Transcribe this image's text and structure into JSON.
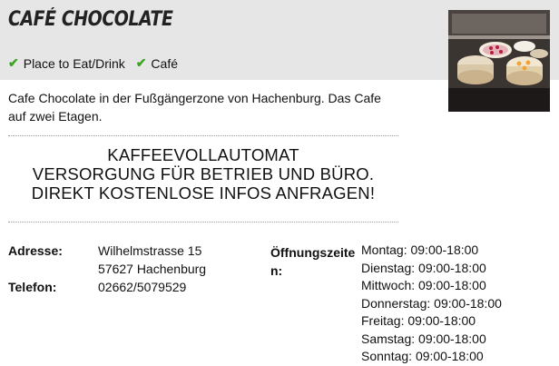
{
  "listing": {
    "title": "CAFÉ CHOCOLATE",
    "categories": [
      {
        "label": "Place to Eat/Drink",
        "icon": "check-icon"
      },
      {
        "label": "Café",
        "icon": "check-icon"
      }
    ],
    "description": "Cafe Chocolate in der Fußgängerzone von Hachenburg. Das Cafe auf zwei Etagen.",
    "photo_icon": "cake-display-photo"
  },
  "ad": {
    "line1": "KAFFEEVOLLAUTOMAT",
    "line2": "VERSORGUNG FÜR BETRIEB UND BÜRO.",
    "line3": "DIREKT KOSTENLOSE INFOS ANFRAGEN!"
  },
  "details": {
    "address_label": "Adresse:",
    "street": "Wilhelmstrasse 15",
    "city": "57627 Hachenburg",
    "phone_label": "Telefon:",
    "phone": "02662/5079529",
    "hours_label_1": "Öffnungszeite",
    "hours_label_2": "n:",
    "hours": [
      "Montag: 09:00-18:00",
      "Dienstag: 09:00-18:00",
      "Mittwoch: 09:00-18:00",
      "Donnerstag: 09:00-18:00",
      "Freitag: 09:00-18:00",
      "Samstag: 09:00-18:00",
      "Sonntag: 09:00-18:00"
    ]
  },
  "colors": {
    "header_bg": "#e6e6e6",
    "check": "#3aa41f"
  }
}
